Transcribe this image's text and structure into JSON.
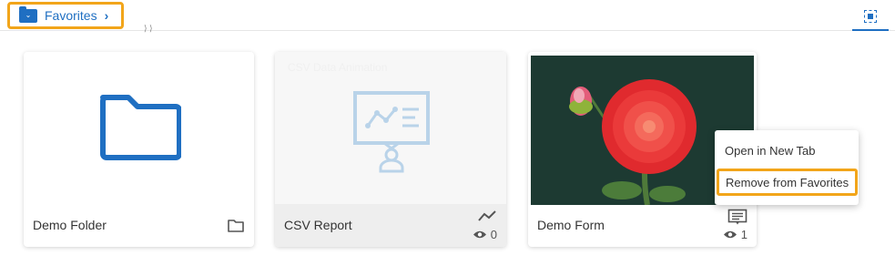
{
  "breadcrumb": {
    "label": "Favorites",
    "arrow": "›"
  },
  "ghost_crumb": "⟩ ⟩",
  "colors": {
    "accent": "#1f6fc2",
    "highlight": "#f2a51a"
  },
  "cards": [
    {
      "title": "Demo Folder",
      "icon": "folder-icon"
    },
    {
      "title": "CSV Report",
      "icon": "trend-line-icon",
      "views": "0",
      "preview_ghost_text": "CSV Data Animation"
    },
    {
      "title": "Demo Form",
      "icon": "form-icon",
      "views": "1",
      "preview": "red-dahlia-flower-image"
    }
  ],
  "context_menu": {
    "items": [
      "Open in New Tab",
      "Remove from Favorites"
    ]
  }
}
